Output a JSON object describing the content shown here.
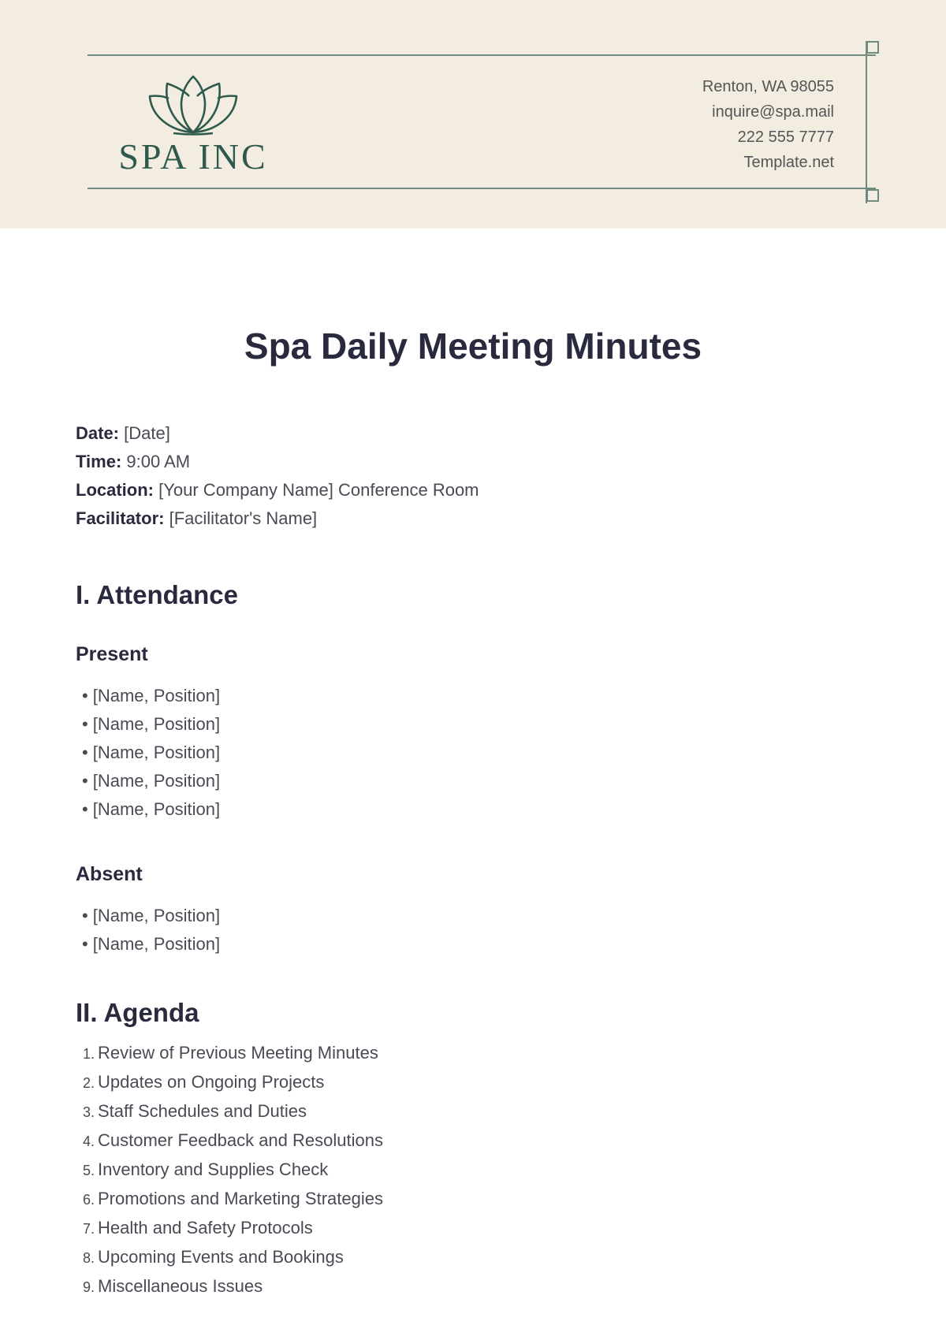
{
  "header": {
    "logo_text": "SPA INC",
    "contact": {
      "address": "Renton, WA 98055",
      "email": "inquire@spa.mail",
      "phone": "222 555 7777",
      "website": "Template.net"
    },
    "colors": {
      "background": "#f3ede1",
      "accent": "#2e5a4e",
      "line": "#6f8a7f"
    }
  },
  "title": "Spa Daily Meeting Minutes",
  "meta": {
    "date_label": "Date:",
    "date_value": "[Date]",
    "time_label": "Time:",
    "time_value": "9:00 AM",
    "location_label": "Location:",
    "location_value": "[Your Company Name] Conference Room",
    "facilitator_label": "Facilitator:",
    "facilitator_value": "[Facilitator's Name]"
  },
  "attendance": {
    "heading": "I. Attendance",
    "present_heading": "Present",
    "present": [
      "[Name, Position]",
      "[Name, Position]",
      "[Name, Position]",
      "[Name, Position]",
      "[Name, Position]"
    ],
    "absent_heading": "Absent",
    "absent": [
      "[Name, Position]",
      "[Name, Position]"
    ]
  },
  "agenda": {
    "heading": "II. Agenda",
    "items": [
      {
        "num": "1.",
        "text": "Review of Previous Meeting Minutes"
      },
      {
        "num": "2.",
        "text": "Updates on Ongoing Projects"
      },
      {
        "num": "3.",
        "text": "Staff Schedules and Duties"
      },
      {
        "num": "4.",
        "text": "Customer Feedback and Resolutions"
      },
      {
        "num": "5.",
        "text": "Inventory and Supplies Check"
      },
      {
        "num": "6.",
        "text": "Promotions and Marketing Strategies"
      },
      {
        "num": "7.",
        "text": "Health and Safety Protocols"
      },
      {
        "num": "8.",
        "text": "Upcoming Events and Bookings"
      },
      {
        "num": "9.",
        "text": "Miscellaneous Issues"
      }
    ]
  }
}
